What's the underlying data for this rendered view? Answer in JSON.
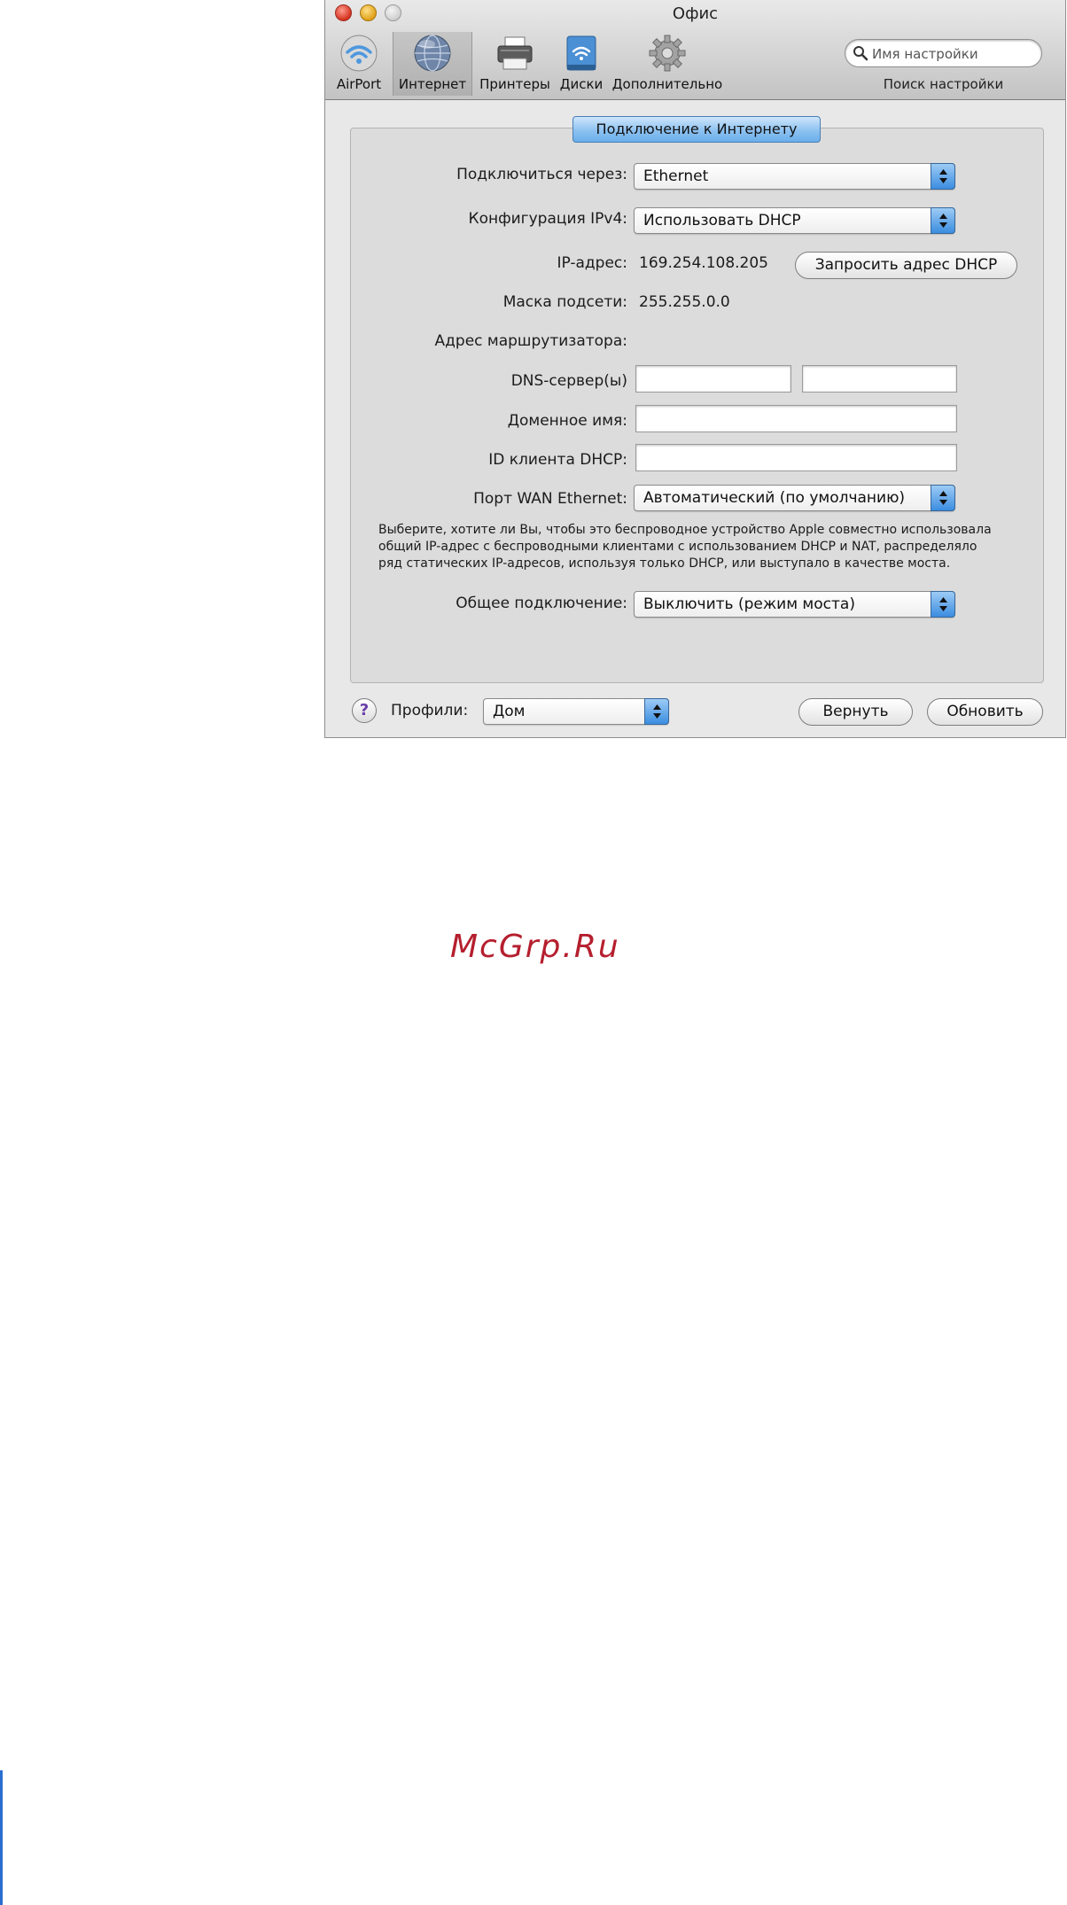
{
  "window": {
    "title": "Офис"
  },
  "toolbar": {
    "items": [
      {
        "label": "AirPort",
        "icon": "airport-wifi-icon"
      },
      {
        "label": "Интернет",
        "icon": "globe-icon",
        "selected": true
      },
      {
        "label": "Принтеры",
        "icon": "printer-icon"
      },
      {
        "label": "Диски",
        "icon": "disk-icon"
      },
      {
        "label": "Дополнительно",
        "icon": "gear-icon"
      }
    ],
    "search_placeholder": "Имя настройки",
    "search_caption": "Поиск настройки"
  },
  "tab": {
    "label": "Подключение к Интернету"
  },
  "form": {
    "connect_via": {
      "label": "Подключиться через:",
      "value": "Ethernet"
    },
    "ipv4_config": {
      "label": "Конфигурация IPv4:",
      "value": "Использовать DHCP"
    },
    "ip_address": {
      "label": "IP-адрес:",
      "value": "169.254.108.205",
      "button": "Запросить адрес DHCP"
    },
    "subnet_mask": {
      "label": "Маска подсети:",
      "value": "255.255.0.0"
    },
    "router_address": {
      "label": "Адрес маршрутизатора:",
      "value": ""
    },
    "dns_servers": {
      "label": "DNS-сервер(ы)",
      "value1": "",
      "value2": ""
    },
    "domain_name": {
      "label": "Доменное имя:",
      "value": ""
    },
    "dhcp_client_id": {
      "label": "ID клиента DHCP:",
      "value": ""
    },
    "wan_port": {
      "label": "Порт WAN Ethernet:",
      "value": "Автоматический (по умолчанию)"
    },
    "description": [
      "Выберите, хотите ли Вы, чтобы это беспроводное устройство Apple совместно использовала",
      "общий IP-адрес с беспроводными клиентами с использованием DHCP и NAT, распределяло",
      "ряд статических IP-адресов, используя только DHCP, или выступало в качестве моста."
    ],
    "sharing": {
      "label": "Общее подключение:",
      "value": "Выключить (режим моста)"
    }
  },
  "footer": {
    "help": "?",
    "profiles_label": "Профили:",
    "profile_value": "Дом",
    "revert": "Вернуть",
    "update": "Обновить"
  },
  "watermark": "McGrp.Ru",
  "colors": {
    "accent": "#6aaeea",
    "watermark": "#b51f2e",
    "edge_bar": "#2a6fd0"
  }
}
